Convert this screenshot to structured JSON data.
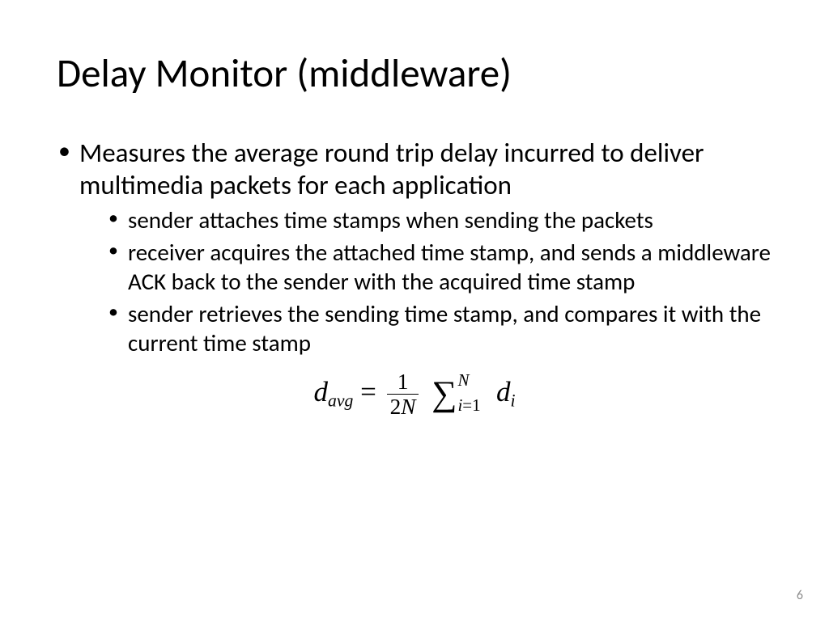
{
  "title": "Delay Monitor (middleware)",
  "bullets": {
    "main": "Measures the average round trip delay incurred to deliver multimedia packets for each application",
    "subs": [
      "sender attaches time stamps when sending the packets",
      "receiver acquires the attached time stamp, and sends a middleware ACK back to the sender with the acquired time stamp",
      "sender retrieves the sending time stamp, and compares it with the current time stamp"
    ]
  },
  "formula": {
    "lhs_var": "d",
    "lhs_sub": "avg",
    "eq": " = ",
    "frac_num": "1",
    "frac_den_coef": "2",
    "frac_den_var": "N",
    "sum_top": "N",
    "sum_lo_var": "i",
    "sum_lo_eq": "=1",
    "term_var": "d",
    "term_sub": "i"
  },
  "page_number": "6"
}
